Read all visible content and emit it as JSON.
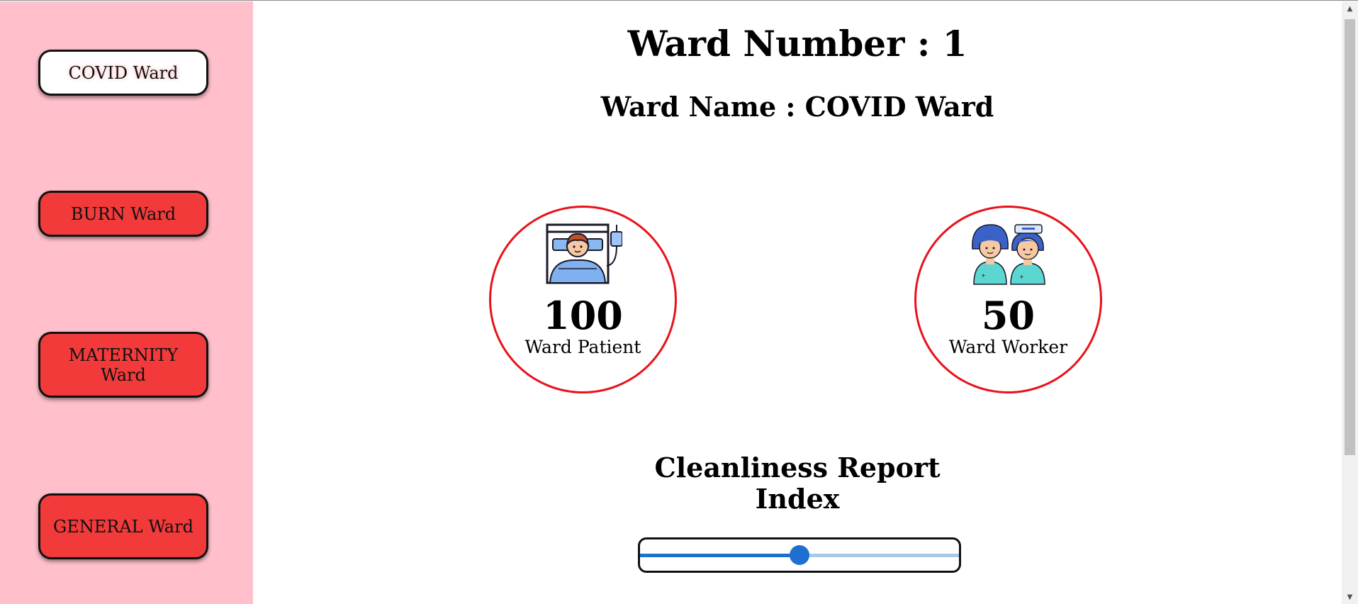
{
  "sidebar": {
    "items": [
      {
        "label": "COVID Ward",
        "active": true
      },
      {
        "label": "BURN Ward",
        "active": false
      },
      {
        "label": "MATERNITY Ward",
        "active": false
      },
      {
        "label": "GENERAL Ward",
        "active": false
      }
    ]
  },
  "header": {
    "title": "Ward Number : 1",
    "subtitle": "Ward Name : COVID Ward"
  },
  "stats": {
    "patients": {
      "value": "100",
      "label": "Ward Patient",
      "icon": "patient-in-bed-icon"
    },
    "workers": {
      "value": "50",
      "label": "Ward Worker",
      "icon": "nurses-icon"
    }
  },
  "cleanliness": {
    "title_line1": "Cleanliness Report",
    "title_line2": "Index",
    "slider_fraction": 0.5
  },
  "colors": {
    "sidebar_bg": "#ffc0cb",
    "button_red": "#f23a3a",
    "circle_border": "#e8121a",
    "slider_blue": "#1e6fd0"
  }
}
